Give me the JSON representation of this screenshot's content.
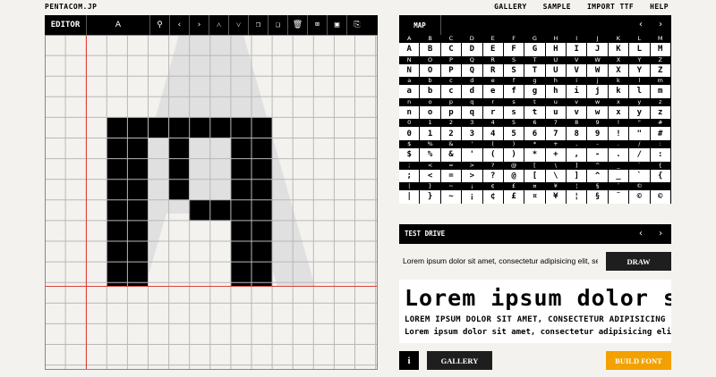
{
  "header": {
    "logo": "PENTACOM.JP",
    "nav": [
      "GALLERY",
      "SAMPLE",
      "IMPORT TTF",
      "HELP"
    ]
  },
  "editor": {
    "title": "EDITOR",
    "current_char": "A",
    "tools": [
      "wand-icon",
      "prev-icon",
      "next-icon",
      "up-icon",
      "down-icon",
      "copy-icon",
      "paste-icon",
      "trash-icon",
      "open-icon",
      "save-icon",
      "export-icon"
    ],
    "tool_glyphs": [
      "⚲",
      "‹",
      "›",
      "˄",
      "˅",
      "❐",
      "❏",
      "🗑",
      "⌧",
      "▣",
      "⎘"
    ]
  },
  "map": {
    "title": "MAP",
    "nav_prev": "‹",
    "nav_next": "›",
    "rows": [
      [
        [
          "A",
          "A"
        ],
        [
          "B",
          "B"
        ],
        [
          "C",
          "C"
        ],
        [
          "D",
          "D"
        ],
        [
          "E",
          "E"
        ],
        [
          "F",
          "F"
        ],
        [
          "G",
          "G"
        ],
        [
          "H",
          "H"
        ],
        [
          "I",
          "I"
        ],
        [
          "J",
          "J"
        ],
        [
          "K",
          "K"
        ],
        [
          "L",
          "L"
        ],
        [
          "M",
          "M"
        ]
      ],
      [
        [
          "N",
          "N"
        ],
        [
          "O",
          "O"
        ],
        [
          "P",
          "P"
        ],
        [
          "Q",
          "Q"
        ],
        [
          "R",
          "R"
        ],
        [
          "S",
          "S"
        ],
        [
          "T",
          "T"
        ],
        [
          "U",
          "U"
        ],
        [
          "V",
          "V"
        ],
        [
          "W",
          "W"
        ],
        [
          "X",
          "X"
        ],
        [
          "Y",
          "Y"
        ],
        [
          "Z",
          "Z"
        ]
      ],
      [
        [
          "a",
          "a"
        ],
        [
          "b",
          "b"
        ],
        [
          "c",
          "c"
        ],
        [
          "d",
          "d"
        ],
        [
          "e",
          "e"
        ],
        [
          "f",
          "f"
        ],
        [
          "g",
          "g"
        ],
        [
          "h",
          "h"
        ],
        [
          "i",
          "i"
        ],
        [
          "j",
          "j"
        ],
        [
          "k",
          "k"
        ],
        [
          "l",
          "l"
        ],
        [
          "m",
          "m"
        ]
      ],
      [
        [
          "n",
          "n"
        ],
        [
          "o",
          "o"
        ],
        [
          "p",
          "p"
        ],
        [
          "q",
          "q"
        ],
        [
          "r",
          "r"
        ],
        [
          "s",
          "s"
        ],
        [
          "t",
          "t"
        ],
        [
          "u",
          "u"
        ],
        [
          "v",
          "v"
        ],
        [
          "w",
          "w"
        ],
        [
          "x",
          "x"
        ],
        [
          "y",
          "y"
        ],
        [
          "z",
          "z"
        ]
      ],
      [
        [
          "0",
          "0"
        ],
        [
          "1",
          "1"
        ],
        [
          "2",
          "2"
        ],
        [
          "3",
          "3"
        ],
        [
          "4",
          "4"
        ],
        [
          "5",
          "5"
        ],
        [
          "6",
          "6"
        ],
        [
          "7",
          "7"
        ],
        [
          "8",
          "8"
        ],
        [
          "9",
          "9"
        ],
        [
          "!",
          "!"
        ],
        [
          "\"",
          "\""
        ],
        [
          "#",
          "#"
        ]
      ],
      [
        [
          "$",
          "$"
        ],
        [
          "%",
          "%"
        ],
        [
          "&",
          "&"
        ],
        [
          "'",
          "'"
        ],
        [
          "(",
          "("
        ],
        [
          ")",
          ")"
        ],
        [
          "*",
          "*"
        ],
        [
          "+",
          "+"
        ],
        [
          ",",
          ","
        ],
        [
          "-",
          "-"
        ],
        [
          ".",
          "."
        ],
        [
          "/",
          "/"
        ],
        [
          ":",
          ":"
        ]
      ],
      [
        [
          ";",
          ";"
        ],
        [
          "<",
          "<"
        ],
        [
          "=",
          "="
        ],
        [
          ">",
          ">"
        ],
        [
          "?",
          "?"
        ],
        [
          "@",
          "@"
        ],
        [
          "[",
          "["
        ],
        [
          "\\",
          "\\"
        ],
        [
          "]",
          "]"
        ],
        [
          "^",
          "^"
        ],
        [
          "_",
          "_"
        ],
        [
          "`",
          "`"
        ],
        [
          "{",
          "{"
        ]
      ],
      [
        [
          "|",
          "|"
        ],
        [
          "}",
          "}"
        ],
        [
          "~",
          "~"
        ],
        [
          "¡",
          "¡"
        ],
        [
          "¢",
          "¢"
        ],
        [
          "£",
          "£"
        ],
        [
          "¤",
          "¤"
        ],
        [
          "¥",
          "¥"
        ],
        [
          "¦",
          "¦"
        ],
        [
          "§",
          "§"
        ],
        [
          "¨",
          "¨"
        ],
        [
          "©",
          "©"
        ],
        [
          "",
          "©"
        ]
      ]
    ]
  },
  "test_drive": {
    "title": "TEST DRIVE",
    "nav_prev": "‹",
    "nav_next": "›",
    "input_value": "Lorem ipsum dolor sit amet, consectetur adipisicing elit, sed",
    "draw_label": "DRAW",
    "preview_big": "Lorem ipsum dolor sit",
    "preview_caps": "LOREM IPSUM DOLOR SIT AMET, CONSECTETUR ADIPISICING",
    "preview_small": "Lorem ipsum dolor sit amet, consectetur adipisicing elit"
  },
  "footer": {
    "info_label": "i",
    "gallery_label": "GALLERY",
    "build_label": "BUILD FONT"
  },
  "colors": {
    "accent": "#f2a100",
    "guide_red": "#e0403a",
    "grid": "#b8b8b8",
    "glyph_fill": "#000000",
    "ghost": "#e0e0e0"
  }
}
